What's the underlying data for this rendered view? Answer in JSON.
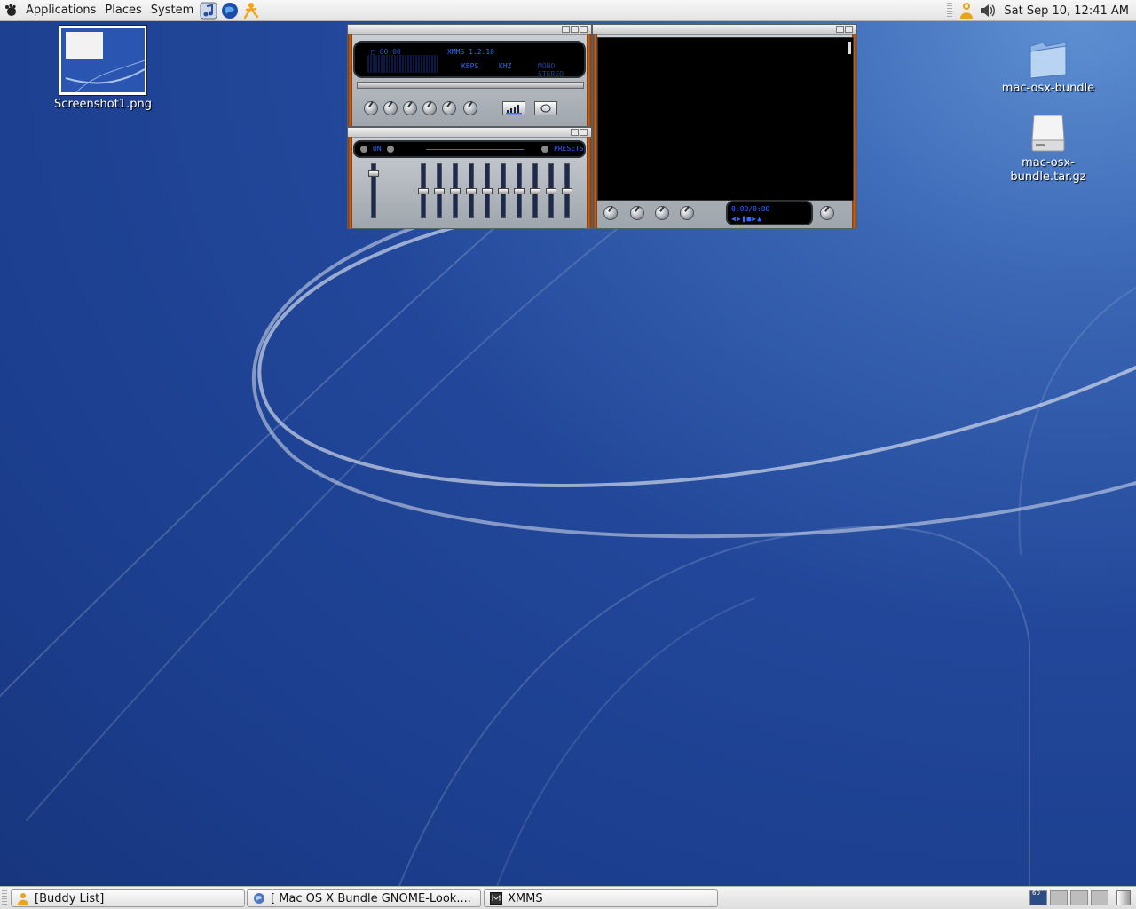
{
  "top_panel": {
    "menus": [
      "Applications",
      "Places",
      "System"
    ],
    "launchers": [
      "music-player-icon",
      "web-browser-icon",
      "aim-icon"
    ],
    "clock": "Sat Sep 10, 12:41 AM",
    "tray": [
      "buddy-icon",
      "volume-icon"
    ]
  },
  "desktop": {
    "icons": [
      {
        "label": "Screenshot1.png"
      },
      {
        "label": "mac-osx-bundle"
      },
      {
        "label": "mac-osx-bundle.tar.gz"
      }
    ]
  },
  "xmms": {
    "title": "XMMS 1.2.10",
    "kbps_label": "KBPS",
    "khz_label": "KHZ",
    "mode_label": "MONO STEREO",
    "eq_on_label": "ON",
    "eq_presets_label": "PRESETS",
    "playlist_time": "0:00/0:00",
    "eq_preamp_level": 0.85,
    "eq_band_levels": [
      0.5,
      0.5,
      0.5,
      0.5,
      0.5,
      0.5,
      0.5,
      0.5,
      0.5,
      0.5
    ]
  },
  "taskbar": {
    "items": [
      {
        "label": "[Buddy List]",
        "icon": "buddy-icon"
      },
      {
        "label": "[ Mac OS X Bundle GNOME-Look....",
        "icon": "globe-icon"
      },
      {
        "label": "XMMS",
        "icon": "xmms-icon"
      }
    ],
    "workspace_label": "60"
  },
  "colors": {
    "desktop_blue": "#1f3f8f",
    "lcd_text": "#2f6bff",
    "xmms_wood": "#c0621e"
  }
}
